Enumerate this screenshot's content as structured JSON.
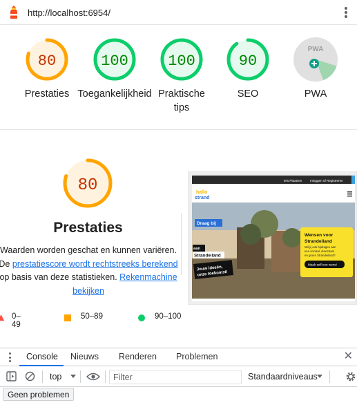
{
  "browser": {
    "url": "http://localhost:6954/"
  },
  "gauges": [
    {
      "score": "80",
      "label": "Prestaties",
      "color": "#ffa400",
      "fill": "#fff3e0",
      "text_color": "#c33300",
      "percent": 80
    },
    {
      "score": "100",
      "label": "Toegankelijkheid",
      "color": "#0cce6b",
      "fill": "#e6f9ef",
      "text_color": "#008800",
      "percent": 100
    },
    {
      "score": "100",
      "label_line1": "Praktische",
      "label_line2": "tips",
      "color": "#0cce6b",
      "fill": "#e6f9ef",
      "text_color": "#008800",
      "percent": 100
    },
    {
      "score": "90",
      "label": "SEO",
      "color": "#0cce6b",
      "fill": "#e6f9ef",
      "text_color": "#008800",
      "percent": 90
    },
    {
      "badge_text": "PWA",
      "label": "PWA"
    }
  ],
  "detail": {
    "score": "80",
    "percent": 80,
    "title": "Prestaties",
    "desc_text1": "Waarden worden geschat en kunnen variëren. De",
    "desc_link1": "prestatiescore wordt rechtstreeks berekend",
    "desc_text2": " op basis van deze statistieken. ",
    "desc_link2": "Rekenmachine bekijken"
  },
  "legend": [
    {
      "range": "0–49",
      "color": "#ff4e42",
      "shape": "triangle"
    },
    {
      "range": "50–89",
      "color": "#ffa400",
      "shape": "square"
    },
    {
      "range": "90–100",
      "color": "#0cce6b",
      "shape": "circle"
    }
  ],
  "screenshot": {
    "topbar_link1": "iets Plaatsen",
    "topbar_link2": "Inloggen of Registreren",
    "logo_line1": "hallo",
    "logo_line2": "strand",
    "banner1": "Draag bij",
    "banner2": "aan",
    "banner3": "Strandeiland",
    "banner4": "Jouw ideeën,",
    "banner5": "onze toekomst!",
    "card_title_line1": "Wensen voor",
    "card_title_line2": "Strandeiland",
    "card_text_line1": "Wil jij ook bijdragen aan",
    "card_text_line2": "een sociaal, duurzaam",
    "card_text_line3": "en groen Strandeiland?",
    "card_button": "Maak zelf een wens!"
  },
  "devtools": {
    "tabs": [
      "Console",
      "Nieuws",
      "Renderen",
      "Problemen"
    ],
    "context": "top",
    "filter_placeholder": "Filter",
    "levels": "Standaardniveaus",
    "issues_button": "Geen problemen"
  }
}
